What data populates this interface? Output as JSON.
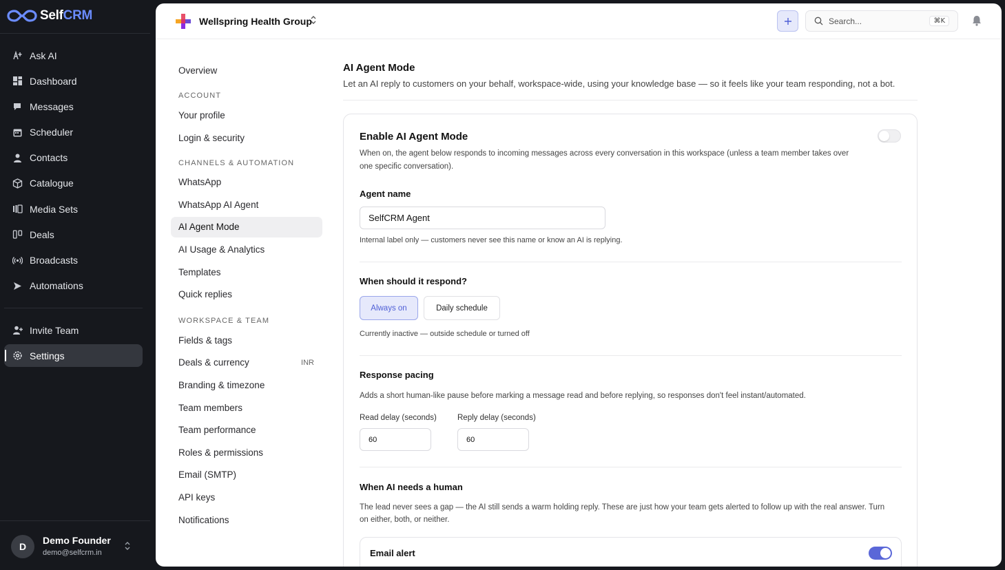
{
  "app": {
    "logo_self": "Self",
    "logo_crm": "CRM",
    "nav": [
      {
        "label": "Ask AI",
        "icon": "sparkle-text-icon"
      },
      {
        "label": "Dashboard",
        "icon": "dashboard-icon"
      },
      {
        "label": "Messages",
        "icon": "messages-icon"
      },
      {
        "label": "Scheduler",
        "icon": "calendar-icon"
      },
      {
        "label": "Contacts",
        "icon": "contacts-icon"
      },
      {
        "label": "Catalogue",
        "icon": "box-icon"
      },
      {
        "label": "Media Sets",
        "icon": "media-icon"
      },
      {
        "label": "Deals",
        "icon": "deals-icon"
      },
      {
        "label": "Broadcasts",
        "icon": "broadcast-icon"
      },
      {
        "label": "Automations",
        "icon": "automation-icon"
      }
    ],
    "nav_bottom": [
      {
        "label": "Invite Team",
        "icon": "invite-icon"
      },
      {
        "label": "Settings",
        "icon": "settings-icon",
        "active": true
      }
    ],
    "user": {
      "initial": "D",
      "name": "Demo Founder",
      "email": "demo@selfcrm.in"
    }
  },
  "topbar": {
    "org_name": "Wellspring Health Group",
    "search_placeholder": "Search...",
    "search_shortcut": "⌘K"
  },
  "settings_nav": {
    "overview": "Overview",
    "sections": [
      {
        "heading": "ACCOUNT",
        "items": [
          {
            "label": "Your profile"
          },
          {
            "label": "Login & security"
          }
        ]
      },
      {
        "heading": "CHANNELS & AUTOMATION",
        "items": [
          {
            "label": "WhatsApp"
          },
          {
            "label": "WhatsApp AI Agent"
          },
          {
            "label": "AI Agent Mode",
            "active": true
          },
          {
            "label": "AI Usage & Analytics"
          },
          {
            "label": "Templates"
          },
          {
            "label": "Quick replies"
          }
        ]
      },
      {
        "heading": "WORKSPACE & TEAM",
        "items": [
          {
            "label": "Fields & tags"
          },
          {
            "label": "Deals & currency",
            "badge": "INR"
          },
          {
            "label": "Branding & timezone"
          },
          {
            "label": "Team members"
          },
          {
            "label": "Team performance"
          },
          {
            "label": "Roles & permissions"
          },
          {
            "label": "Email (SMTP)"
          },
          {
            "label": "API keys"
          },
          {
            "label": "Notifications"
          }
        ]
      }
    ]
  },
  "page": {
    "title": "AI Agent Mode",
    "subtitle": "Let an AI reply to customers on your behalf, workspace-wide, using your knowledge base — so it feels like your team responding, not a bot.",
    "enable": {
      "title": "Enable AI Agent Mode",
      "desc": "When on, the agent below responds to incoming messages across every conversation in this workspace (unless a team member takes over one specific conversation).",
      "enabled": false
    },
    "agent_name": {
      "label": "Agent name",
      "value": "SelfCRM Agent",
      "hint": "Internal label only — customers never see this name or know an AI is replying."
    },
    "respond": {
      "label": "When should it respond?",
      "options": [
        "Always on",
        "Daily schedule"
      ],
      "selected": "Always on",
      "status": "Currently inactive — outside schedule or turned off"
    },
    "pacing": {
      "label": "Response pacing",
      "desc": "Adds a short human-like pause before marking a message read and before replying, so responses don't feel instant/automated.",
      "read_label": "Read delay (seconds)",
      "read_value": "60",
      "reply_label": "Reply delay (seconds)",
      "reply_value": "60"
    },
    "human": {
      "label": "When AI needs a human",
      "desc": "The lead never sees a gap — the AI still sends a warm holding reply. These are just how your team gets alerted to follow up with the real answer. Turn on either, both, or neither.",
      "email_alert_label": "Email alert",
      "email_alert_enabled": true
    }
  },
  "colors": {
    "accent": "#5a67d8",
    "sidebar_bg": "#16181d"
  }
}
